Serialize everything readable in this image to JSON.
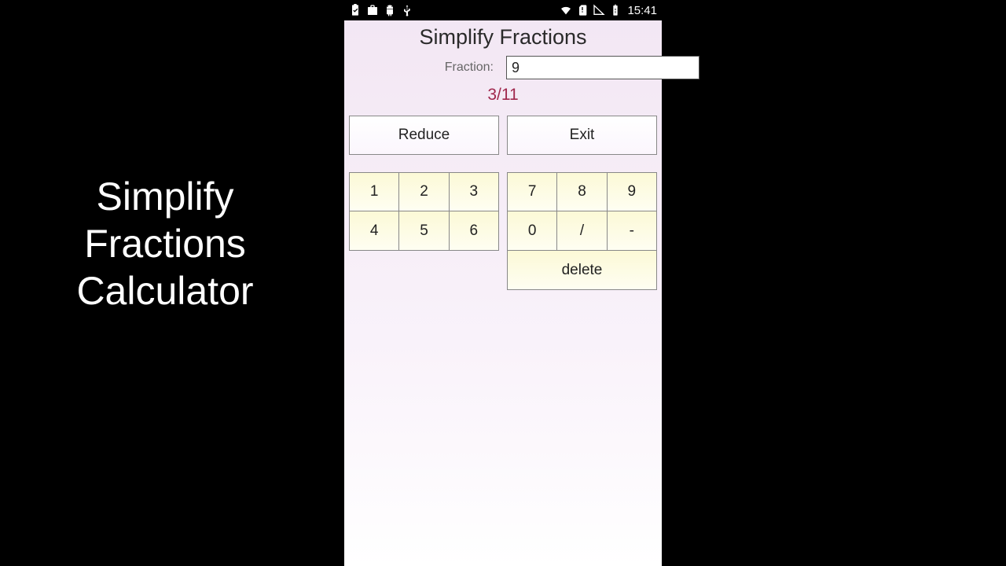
{
  "caption": "Simplify Fractions Calculator",
  "statusbar": {
    "time": "15:41"
  },
  "app": {
    "title": "Simplify Fractions",
    "input_label": "Fraction:",
    "input_value": "9",
    "result": "3/11",
    "reduce_label": "Reduce",
    "exit_label": "Exit"
  },
  "keypad": {
    "left": [
      [
        "1",
        "2",
        "3"
      ],
      [
        "4",
        "5",
        "6"
      ]
    ],
    "right": [
      [
        "7",
        "8",
        "9"
      ],
      [
        "0",
        "/",
        "-"
      ]
    ],
    "delete_label": "delete"
  }
}
